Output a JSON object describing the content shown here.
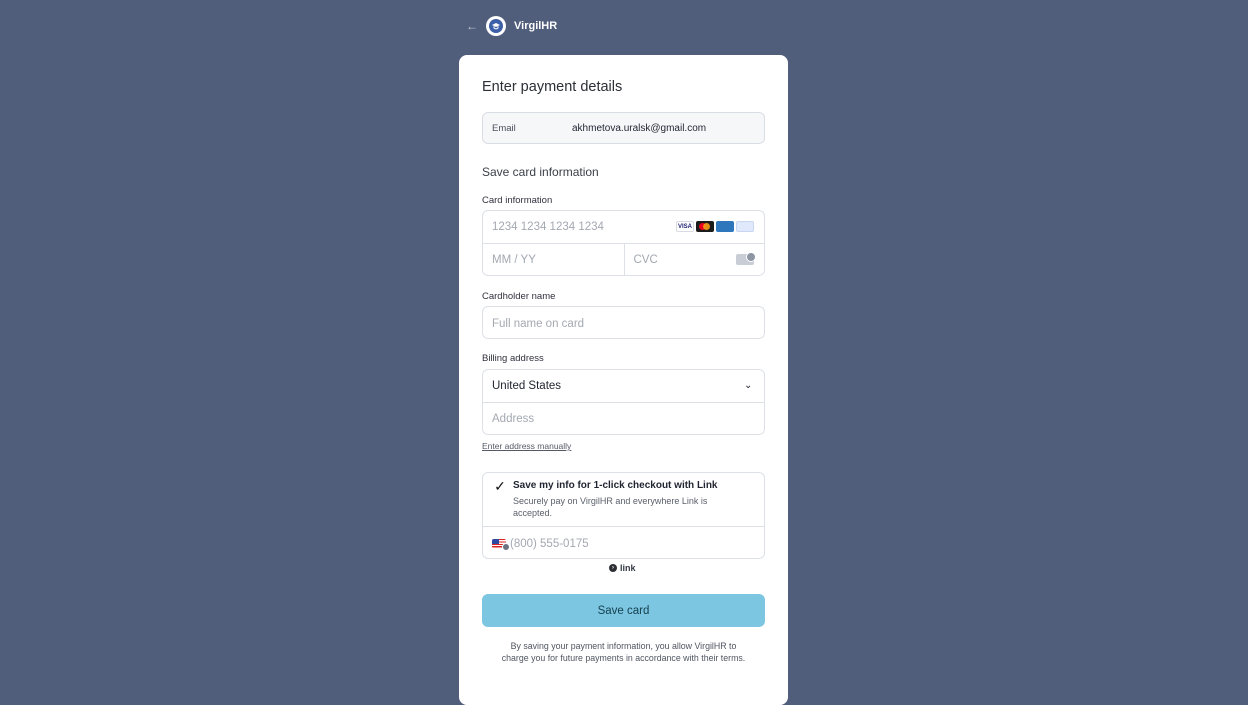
{
  "top": {
    "back_icon": "arrow-left-icon",
    "brand": "VirgilHR"
  },
  "form": {
    "title": "Enter payment details",
    "email_label": "Email",
    "email_value": "akhmetova.uralsk@gmail.com",
    "section_title": "Save card information",
    "card_information_label": "Card information",
    "card_number_placeholder": "1234 1234 1234 1234",
    "expiry_placeholder": "MM / YY",
    "cvc_placeholder": "CVC",
    "cardholder_label": "Cardholder name",
    "cardholder_placeholder": "Full name on card",
    "billing_label": "Billing address",
    "country_value": "United States",
    "address_placeholder": "Address",
    "manual_link": "Enter address manually",
    "link_title": "Save my info for 1-click checkout with Link",
    "link_subtitle": "Securely pay on VirgilHR and everywhere Link is accepted.",
    "phone_placeholder": "(800) 555-0175",
    "link_brand": "link",
    "save_button": "Save card",
    "footer": "By saving your payment information, you allow VirgilHR to charge you for future payments in accordance with their terms."
  },
  "colors": {
    "background": "#505d7b",
    "button": "#7cc6e2"
  }
}
